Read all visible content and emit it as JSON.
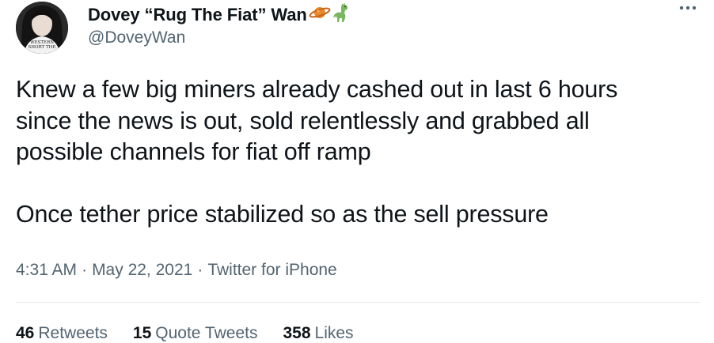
{
  "author": {
    "display_name": "Dovey “Rug The Fiat” Wan",
    "handle": "@DoveyWan",
    "name_emojis": [
      "planet-emoji-icon",
      "dinosaur-emoji-icon"
    ],
    "avatar_caption": "WESTERN SHORT THE"
  },
  "tweet": {
    "paragraphs": [
      "Knew a few big miners already cashed out in last 6 hours\nsince the news is out, sold relentlessly and grabbed all\npossible channels for fiat off ramp",
      "Once tether price stabilized so as the sell pressure"
    ]
  },
  "meta": {
    "time": "4:31 AM",
    "separator": "·",
    "date": "May 22, 2021",
    "source": "Twitter for iPhone"
  },
  "stats": {
    "retweets_count": "46",
    "retweets_label": "Retweets",
    "quote_tweets_count": "15",
    "quote_tweets_label": "Quote Tweets",
    "likes_count": "358",
    "likes_label": "Likes"
  },
  "colors": {
    "text_primary": "#0f1419",
    "text_secondary": "#536471",
    "divider": "#e5e8eb"
  }
}
